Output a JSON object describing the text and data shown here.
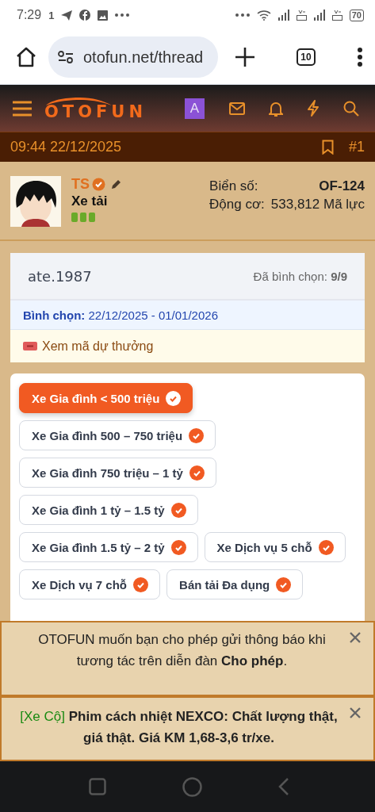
{
  "status_bar": {
    "time": "7:29",
    "notification_count": "1",
    "battery": "70"
  },
  "browser": {
    "url": "otofun.net/thread",
    "tab_count": "10"
  },
  "site_header": {
    "logo": "OTOFUN",
    "account_initial": "A"
  },
  "post_bar": {
    "datetime": "09:44 22/12/2025",
    "post_number": "#1"
  },
  "author": {
    "name": "TS",
    "title": "Xe tải"
  },
  "details": [
    {
      "label": "Biển số:",
      "value": "OF-124",
      "emphasized": true
    },
    {
      "label": "Động cơ:",
      "value": "533,812 Mã lực",
      "emphasized": false
    }
  ],
  "poll": {
    "title": "ate.1987",
    "voted": "Đã bình chọn: **9/9**",
    "period": "**Bình chọn:** 22/12/2025 - 01/01/2026",
    "ticket_link": "Xem mã dự thưởng"
  },
  "options": [
    {
      "label": "Xe Gia đình < 500 triệu",
      "selected": true
    },
    {
      "label": "Xe Gia đình 500 – 750 triệu",
      "selected": false
    },
    {
      "label": "Xe Gia đình 750 triệu – 1 tỷ",
      "selected": false
    },
    {
      "label": "Xe Gia đình 1 tỷ – 1.5 tỷ",
      "selected": false
    },
    {
      "label": "Xe Gia đình 1.5 tỷ – 2 tỷ",
      "selected": false
    },
    {
      "label": "Xe Dịch vụ 5 chỗ",
      "selected": false
    },
    {
      "label": "Xe Dịch vụ 7 chỗ",
      "selected": false
    },
    {
      "label": "Bán tải Đa dụng",
      "selected": false
    }
  ],
  "notices": [
    {
      "kind": "permission",
      "text": "OTOFUN muốn bạn cho phép gửi thông báo khi tương tác trên diễn đàn **Cho phép**."
    },
    {
      "kind": "ad",
      "tag": "[Xe Cộ]",
      "text": "Phim cách nhiệt NEXCO: Chất lượng thật, giá thật. Giá KM 1,68-3,6 tr/xe."
    }
  ]
}
